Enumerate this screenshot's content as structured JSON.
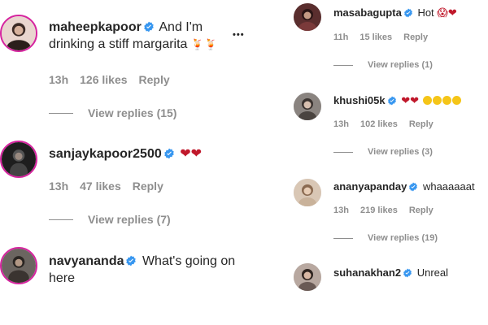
{
  "left": {
    "comments": [
      {
        "username": "maheepkapoor",
        "text_line1": "And I'm",
        "text_line2": "drinking a stiff margarita",
        "text_emoji": "🍹🍹",
        "time": "13h",
        "likes": "126 likes",
        "reply": "Reply",
        "view_replies": "View replies (15)",
        "more": "•••"
      },
      {
        "username": "sanjaykapoor2500",
        "hearts": "❤❤",
        "time": "13h",
        "likes": "47 likes",
        "reply": "Reply",
        "view_replies": "View replies (7)"
      },
      {
        "username": "navyananda",
        "text_line1": "What's going on",
        "text_line2": "here"
      }
    ]
  },
  "right": {
    "comments": [
      {
        "username": "masabagupta",
        "text": "Hot",
        "emoji_tail": "😱❤",
        "time": "11h",
        "likes": "15 likes",
        "reply": "Reply",
        "view_replies": "View replies (1)"
      },
      {
        "username": "khushi05k",
        "hearts": "❤❤",
        "time": "13h",
        "likes": "102 likes",
        "reply": "Reply",
        "view_replies": "View replies (3)"
      },
      {
        "username": "ananyapanday",
        "text": "whaaaaaat",
        "time": "13h",
        "likes": "219 likes",
        "reply": "Reply",
        "view_replies": "View replies (19)"
      },
      {
        "username": "suhanakhan2",
        "text": "Unreal"
      }
    ]
  },
  "colors": {
    "verified": "#3897f0",
    "muted": "#8e8e8e",
    "story_ring": "#d6249f",
    "heart": "#c0182b"
  },
  "icons": [
    "verified-badge-icon",
    "more-options-icon"
  ]
}
